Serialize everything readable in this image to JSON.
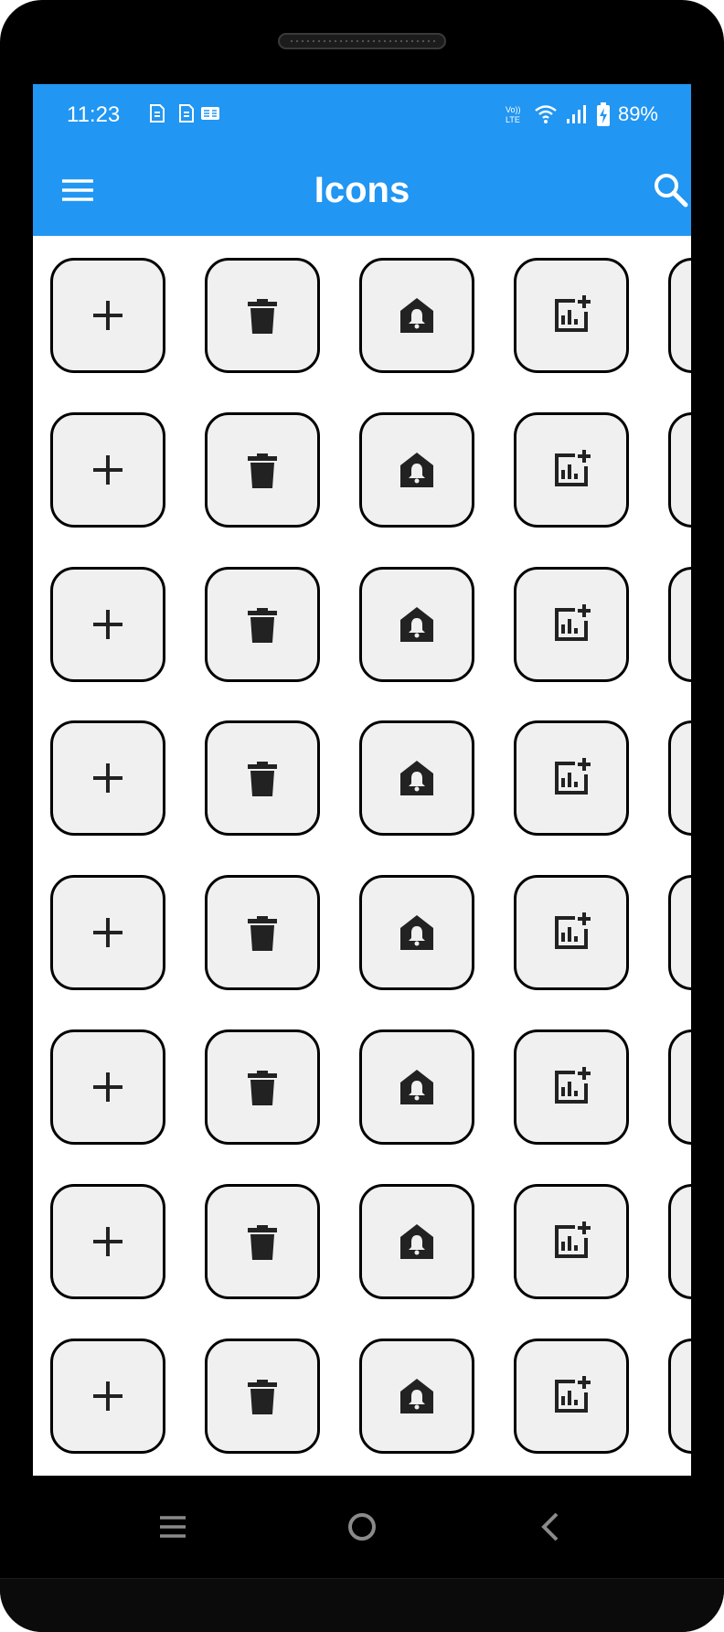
{
  "status": {
    "time": "11:23",
    "battery": "89%",
    "left_icons": [
      "sim-icon",
      "sim-icon",
      "gmail-icon"
    ],
    "right_icons": [
      "volte-icon",
      "wifi-icon",
      "signal-icon",
      "battery-charging-icon"
    ]
  },
  "appbar": {
    "title": "Icons",
    "menu_icon": "menu-icon",
    "search_icon": "search-icon",
    "color": "#2196f3"
  },
  "grid": {
    "rows": 8,
    "columns": [
      "add-icon",
      "delete-icon",
      "home-bell-icon",
      "add-chart-icon",
      "partial-tile"
    ],
    "tile_color": "#eff0ef",
    "border_color": "#000000"
  },
  "navbar": {
    "icons": [
      "recent-apps-icon",
      "home-icon",
      "back-icon"
    ]
  }
}
